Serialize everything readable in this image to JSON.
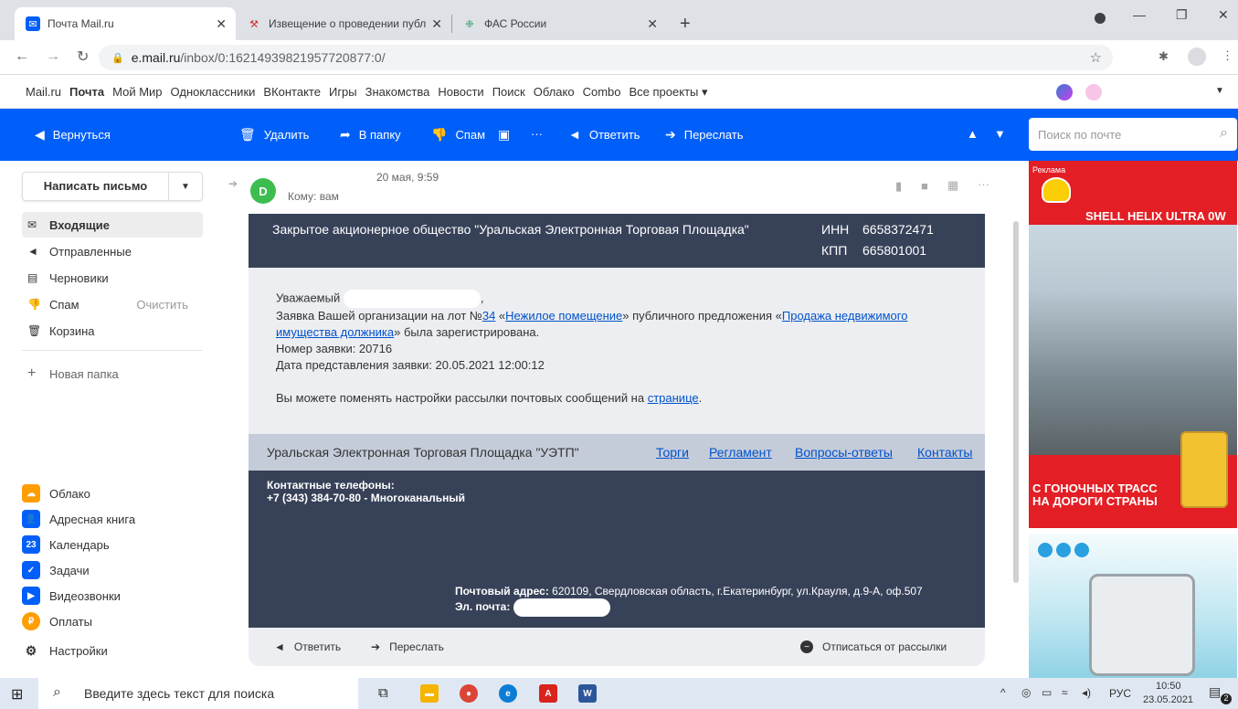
{
  "browser": {
    "tabs": [
      {
        "title": "Почта Mail.ru",
        "active": true
      },
      {
        "title": "Извещение о проведении публ"
      },
      {
        "title": "ФАС России"
      }
    ],
    "new_tab": "+",
    "url_host": "e.mail.ru",
    "url_path": "/inbox/0:16214939821957720877:0/"
  },
  "portal_nav": [
    "Mail.ru",
    "Почта",
    "Мой Мир",
    "Одноклассники",
    "ВКонтакте",
    "Игры",
    "Знакомства",
    "Новости",
    "Поиск",
    "Облако",
    "Combo",
    "Все проекты ▾"
  ],
  "toolbar": {
    "back": "Вернуться",
    "delete": "Удалить",
    "to_folder": "В папку",
    "spam": "Спам",
    "more": "···",
    "reply": "Ответить",
    "forward": "Переслать",
    "search_placeholder": "Поиск по почте"
  },
  "sidebar": {
    "compose": "Написать письмо",
    "folders": [
      {
        "label": "Входящие",
        "icon": "inbox-icon",
        "selected": true
      },
      {
        "label": "Отправленные",
        "icon": "sent-icon"
      },
      {
        "label": "Черновики",
        "icon": "drafts-icon"
      },
      {
        "label": "Спам",
        "icon": "spam-icon",
        "aux": "Очистить"
      },
      {
        "label": "Корзина",
        "icon": "trash-icon"
      }
    ],
    "new_folder": "Новая папка",
    "services": [
      {
        "label": "Облако",
        "color": "#ff9e00"
      },
      {
        "label": "Адресная книга",
        "color": "#005ff9"
      },
      {
        "label": "Календарь",
        "color": "#005ff9",
        "glyph": "23"
      },
      {
        "label": "Задачи",
        "color": "#005ff9"
      },
      {
        "label": "Видеозвонки",
        "color": "#005ff9"
      },
      {
        "label": "Оплаты",
        "color": "#ff9e00"
      }
    ],
    "settings": "Настройки"
  },
  "message": {
    "avatar_letter": "D",
    "date": "20 мая, 9:59",
    "to": "Кому: вам",
    "org_name": "Закрытое акционерное общество \"Уральская Электронная Торговая Площадка\"",
    "inn_label": "ИНН",
    "inn": "6658372471",
    "kpp_label": "КПП",
    "kpp": "665801001",
    "greeting": "Уважаемый",
    "greeting_end": ",",
    "line1_a": "Заявка Вашей организации на лот №",
    "lot_number": "34",
    "line1_b": " «",
    "lot_name": "Нежилое помещение",
    "line1_c": "» публичного предложения «",
    "procedure_name": "Продажа недвижимого имущества должника",
    "line1_d": "» была зарегистрирована.",
    "app_number": "Номер заявки: 20716",
    "app_date": "Дата представления заявки: 20.05.2021 12:00:12",
    "settings_line": "Вы можете поменять настройки рассылки почтовых сообщений на ",
    "settings_link": "странице",
    "settings_end": ".",
    "footer_org": "Уральская Электронная Торговая Площадка \"УЭТП\"",
    "footer_links": [
      "Торги",
      "Регламент",
      "Вопросы-ответы",
      "Контакты"
    ],
    "phones_title": "Контактные телефоны:",
    "phone": "+7 (343) 384-70-80 - Многоканальный",
    "address_label": "Почтовый адрес:",
    "address": " 620109, Свердловская область, г.Екатеринбург, ул.Крауля, д.9-А, оф.507",
    "email_label": "Эл. почта:",
    "action_reply": "Ответить",
    "action_forward": "Переслать",
    "action_unsubscribe": "Отписаться от рассылки"
  },
  "ad": {
    "label": "Реклама",
    "brand": "SHELL HELIX ULTRA 0W",
    "slogan_1": "С ГОНОЧНЫХ ТРАСС",
    "slogan_2": "НА ДОРОГИ СТРАНЫ"
  },
  "taskbar": {
    "search": "Введите здесь текст для поиска",
    "lang": "РУС",
    "time": "10:50",
    "date": "23.05.2021",
    "notif": "2"
  }
}
